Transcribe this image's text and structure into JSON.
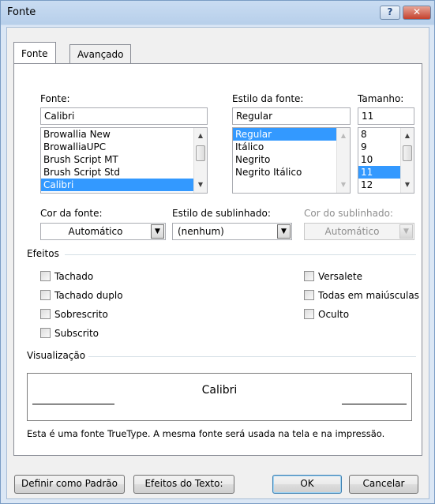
{
  "window": {
    "title": "Fonte",
    "help_label": "?",
    "close_label": "✕"
  },
  "tabs": [
    "Fonte",
    "Avançado"
  ],
  "font": {
    "label": "Fonte:",
    "value": "Calibri",
    "items": [
      "Browallia New",
      "BrowalliaUPC",
      "Brush Script MT",
      "Brush Script Std",
      "Calibri"
    ],
    "selected_index": 4
  },
  "style": {
    "label": "Estilo da fonte:",
    "value": "Regular",
    "items": [
      "Regular",
      "Itálico",
      "Negrito",
      "Negrito Itálico"
    ],
    "selected_index": 0
  },
  "size": {
    "label": "Tamanho:",
    "value": "11",
    "items": [
      "8",
      "9",
      "10",
      "11",
      "12"
    ],
    "selected_index": 3
  },
  "font_color": {
    "label": "Cor da fonte:",
    "value": "Automático"
  },
  "underline_style": {
    "label": "Estilo de sublinhado:",
    "value": "(nenhum)"
  },
  "underline_color": {
    "label": "Cor do sublinhado:",
    "value": "Automático"
  },
  "effects": {
    "label": "Efeitos",
    "left": [
      "Tachado",
      "Tachado duplo",
      "Sobrescrito",
      "Subscrito"
    ],
    "right": [
      "Versalete",
      "Todas em maiúsculas",
      "Oculto"
    ]
  },
  "preview": {
    "label": "Visualização",
    "sample": "Calibri",
    "note": "Esta é uma fonte TrueType. A mesma fonte será usada na tela e na impressão."
  },
  "buttons": {
    "set_default": "Definir como Padrão",
    "text_effects": "Efeitos do Texto:",
    "ok": "OK",
    "cancel": "Cancelar"
  },
  "icons": {
    "scroll_up": "▲",
    "scroll_down": "▼",
    "dropdown": "▼"
  }
}
